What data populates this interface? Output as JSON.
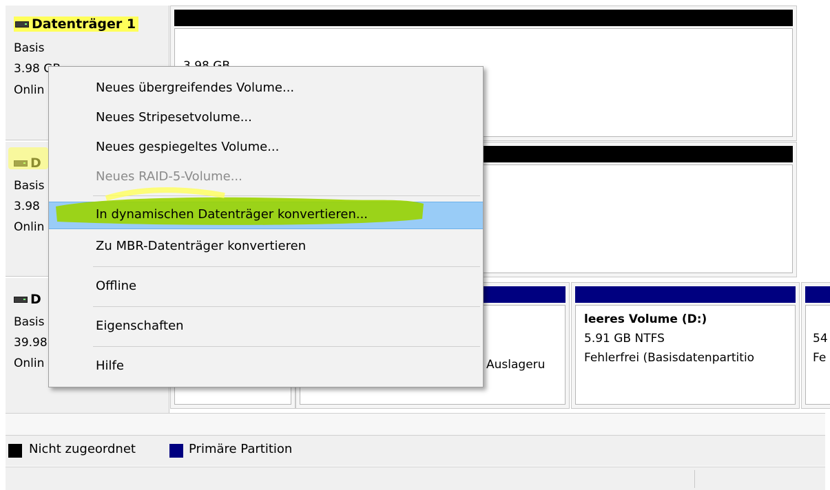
{
  "colors": {
    "unallocated": "#000000",
    "primary_partition": "#000080",
    "menu_highlight": "#99ccf7",
    "marker_yellow": "#ffff5a",
    "marker_green": "#9bd400"
  },
  "disks": [
    {
      "title": "Datenträger 1",
      "type": "Basis",
      "size": "3.98 GB",
      "status": "Onlin",
      "icon": "disk-icon"
    },
    {
      "title": "D",
      "type": "Basis",
      "size": "3.98",
      "status": "Onlin",
      "icon": "disk-icon"
    },
    {
      "title": "D",
      "type": "Basis",
      "size": "39.98",
      "status": "Onlin",
      "icon": "disk-icon"
    }
  ],
  "partitions": {
    "disk1_size_fragment": "3.98 GB",
    "disk3_swap_fragment": "Auslageru",
    "volume_d": {
      "name": "leeres Volume  (D:)",
      "size_fs": "5.91 GB NTFS",
      "status": "Fehlerfrei (Basisdatenpartitio"
    },
    "right_fragment_1": "54",
    "right_fragment_2": "Fe"
  },
  "context_menu": {
    "items": [
      {
        "label": "Neues übergreifendes Volume...",
        "disabled": false
      },
      {
        "label": "Neues Stripesetvolume...",
        "disabled": false
      },
      {
        "label": "Neues gespiegeltes Volume...",
        "disabled": false
      },
      {
        "label": "Neues RAID-5-Volume...",
        "disabled": true
      },
      {
        "label": "In dynamischen Datenträger konvertieren...",
        "disabled": false,
        "highlighted": true
      },
      {
        "label": "Zu MBR-Datenträger konvertieren",
        "disabled": false
      },
      {
        "label": "Offline",
        "disabled": false
      },
      {
        "label": "Eigenschaften",
        "disabled": false
      },
      {
        "label": "Hilfe",
        "disabled": false
      }
    ]
  },
  "legend": {
    "unallocated": "Nicht zugeordnet",
    "primary": "Primäre Partition"
  }
}
